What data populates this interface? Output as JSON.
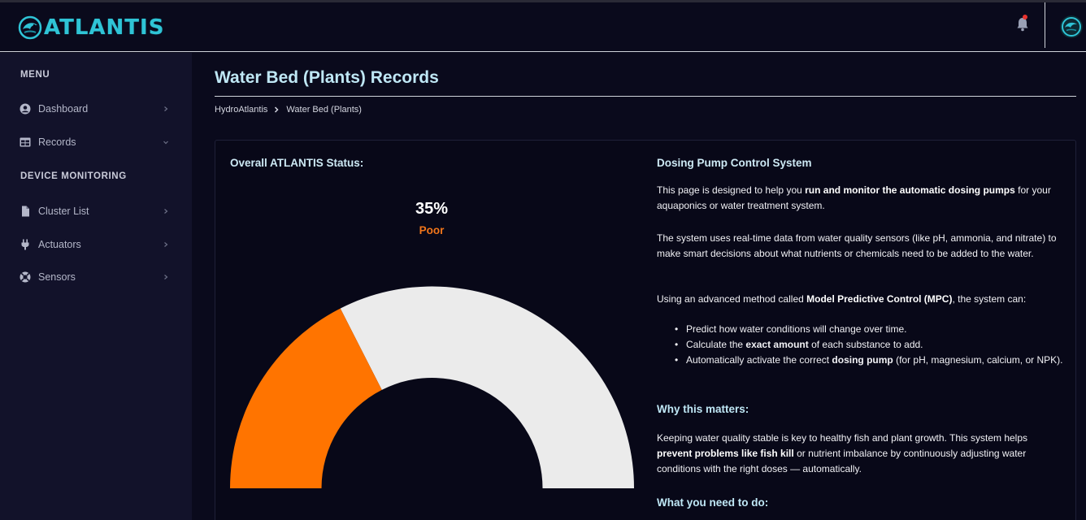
{
  "app": {
    "logo_text": "ATLANTIS",
    "brand_color": "#2fc4d6",
    "icons": [
      "dolphin-logo-icon",
      "bell-icon",
      "avatar-icon"
    ]
  },
  "sidebar": {
    "menu_header": "MENU",
    "device_header": "DEVICE MONITORING",
    "items": [
      {
        "label": "Dashboard",
        "icon": "user-circle-icon",
        "chevron": "chevron-right-icon"
      },
      {
        "label": "Records",
        "icon": "table-icon",
        "chevron": "chevron-down-icon"
      },
      {
        "label": "Cluster List",
        "icon": "file-icon",
        "chevron": "chevron-right-icon"
      },
      {
        "label": "Actuators",
        "icon": "plug-icon",
        "chevron": "chevron-right-icon"
      },
      {
        "label": "Sensors",
        "icon": "lifebuoy-icon",
        "chevron": "chevron-right-icon"
      }
    ]
  },
  "page": {
    "title": "Water Bed (Plants) Records",
    "breadcrumb": [
      "HydroAtlantis",
      "Water Bed (Plants)"
    ]
  },
  "status": {
    "title": "Overall ATLANTIS Status:",
    "percent_text": "35%",
    "level": 0.35,
    "label": "Poor",
    "fill_color": "#ff7400",
    "track_color": "#ebebeb"
  },
  "info": {
    "title": "Dosing Pump Control System",
    "p1_a": "This page is designed to help you ",
    "p1_b": "run and monitor the automatic dosing pumps",
    "p1_c": " for your aquaponics or water treatment system.",
    "p2": "The system uses real-time data from water quality sensors (like pH, ammonia, and nitrate) to make smart decisions about what nutrients or chemicals need to be added to the water.",
    "p3_a": "Using an advanced method called ",
    "p3_b": "Model Predictive Control (MPC)",
    "p3_c": ", the system can:",
    "b1": "Predict how water conditions will change over time.",
    "b2_a": "Calculate the ",
    "b2_b": "exact amount",
    "b2_c": " of each substance to add.",
    "b3_a": "Automatically activate the correct ",
    "b3_b": "dosing pump",
    "b3_c": " (for pH, magnesium, calcium, or NPK).",
    "why_title": "Why this matters:",
    "p4_a": "Keeping water quality stable is key to healthy fish and plant growth. This system helps ",
    "p4_b": "prevent problems like fish kill",
    "p4_c": " or nutrient imbalance by continuously adjusting water conditions with the right doses — automatically.",
    "todo_title": "What you need to do:"
  }
}
